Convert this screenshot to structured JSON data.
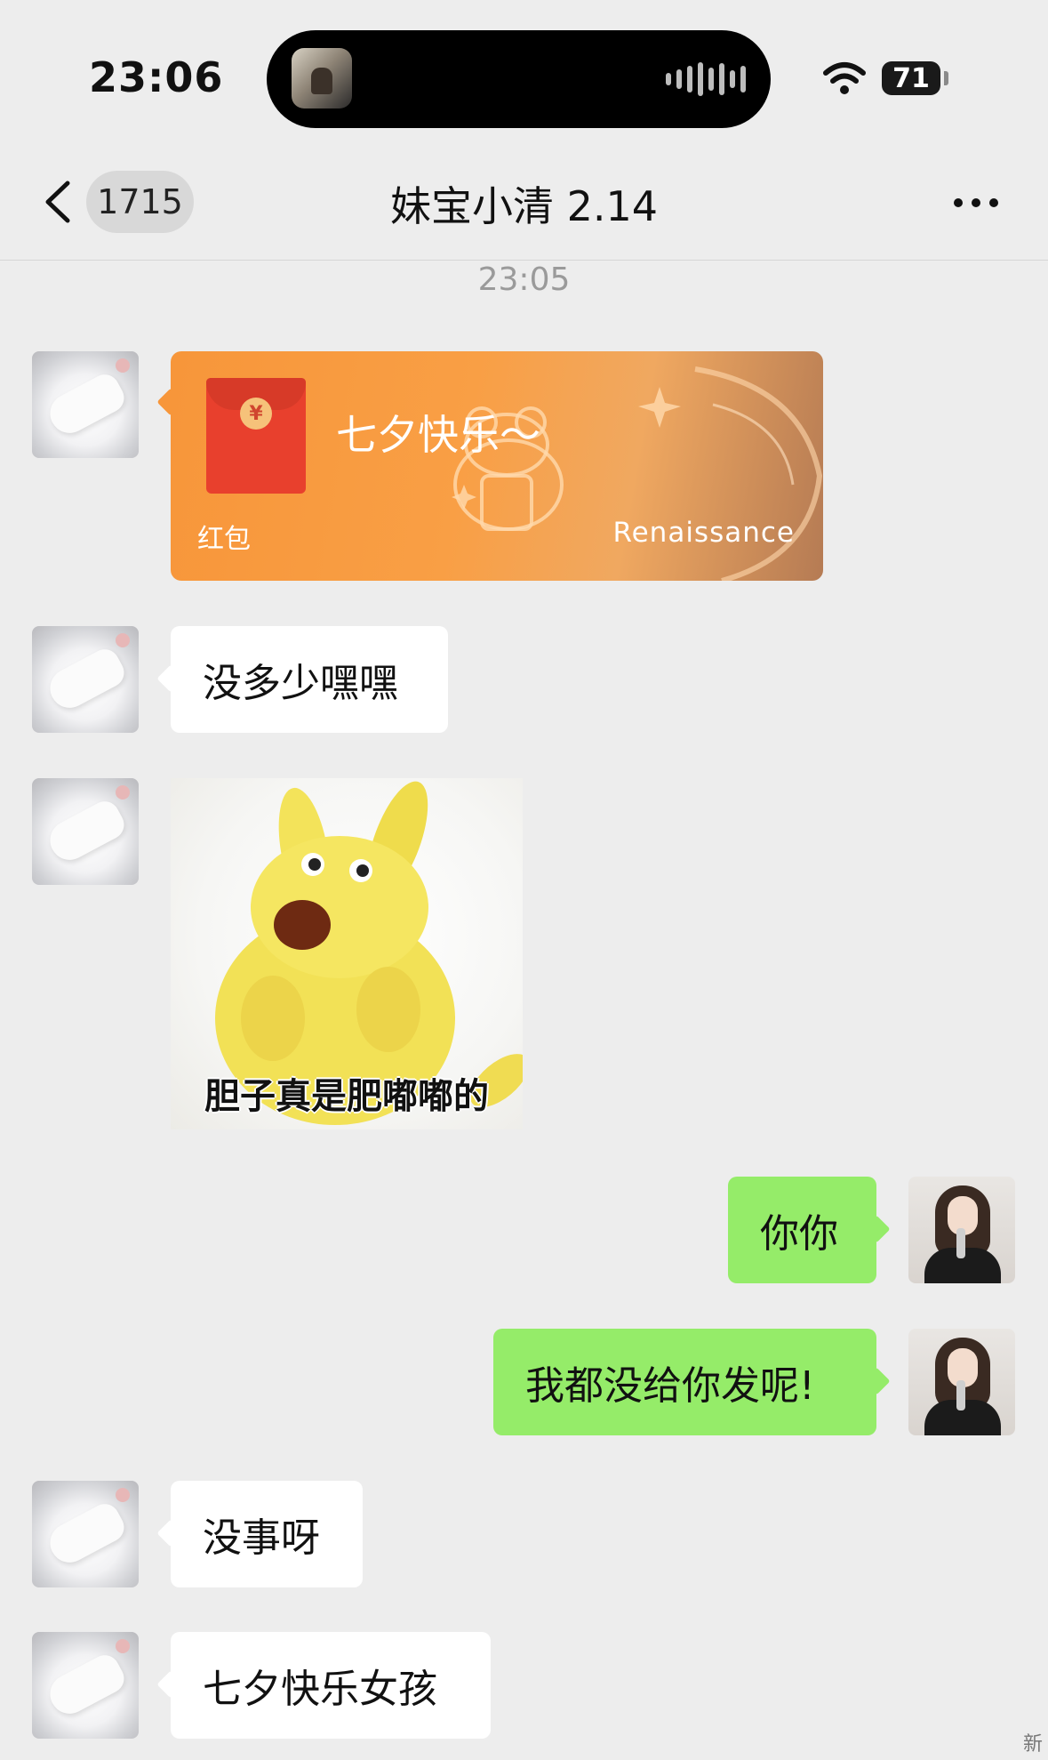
{
  "status_bar": {
    "time": "23:06",
    "battery_level": "71",
    "icons": [
      "now-playing-album-art",
      "audio-waveform-icon",
      "wifi-icon",
      "battery-icon"
    ]
  },
  "nav": {
    "back_icon": "chevron-left-icon",
    "unread_count": "1715",
    "title": "妹宝小清 2.14",
    "more_icon": "more-dots-icon"
  },
  "timestamp": "23:05",
  "red_packet": {
    "title": "七夕快乐～",
    "label": "红包",
    "brand": "Renaissance",
    "envelope_color": "#e8402d",
    "card_color": "#f7963a"
  },
  "messages": [
    {
      "side": "left",
      "type": "text",
      "text": "没多少嘿嘿"
    },
    {
      "side": "left",
      "type": "sticker",
      "caption": "胆子真是肥嘟嘟的"
    },
    {
      "side": "right",
      "type": "text",
      "text": "你你"
    },
    {
      "side": "right",
      "type": "text",
      "text": "我都没给你发呢!"
    },
    {
      "side": "left",
      "type": "text",
      "text": "没事呀"
    },
    {
      "side": "left",
      "type": "text",
      "text": "七夕快乐女孩"
    }
  ],
  "colors": {
    "background": "#ededed",
    "bubble_incoming": "#ffffff",
    "bubble_outgoing": "#95ec69"
  },
  "corner_mark": "新"
}
